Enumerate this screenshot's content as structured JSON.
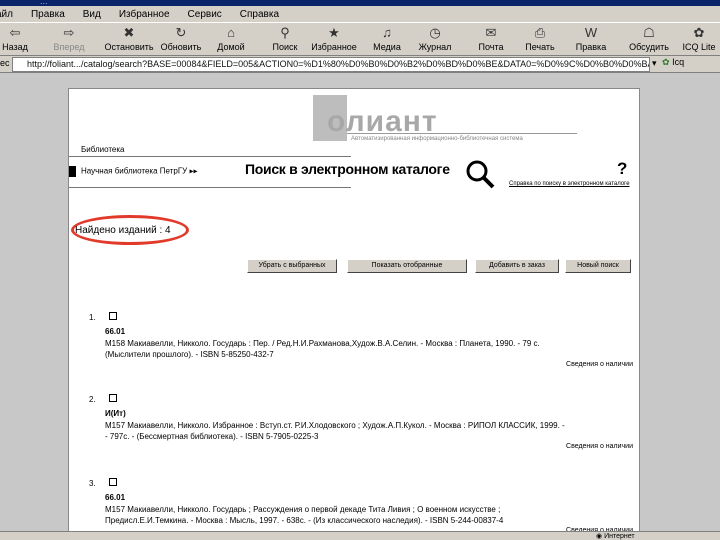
{
  "window": {
    "title": "..."
  },
  "menu": [
    "айл",
    "Правка",
    "Вид",
    "Избранное",
    "Сервис",
    "Справка"
  ],
  "toolbar": {
    "buttons": [
      {
        "label": "Назад",
        "icon": "back-arrow"
      },
      {
        "label": "Вперед",
        "icon": "forward-arrow"
      },
      {
        "label": "Остановить",
        "icon": "stop"
      },
      {
        "label": "Обновить",
        "icon": "refresh"
      },
      {
        "label": "Домой",
        "icon": "home"
      },
      {
        "label": "Поиск",
        "icon": "search"
      },
      {
        "label": "Избранное",
        "icon": "favorites"
      },
      {
        "label": "Медиа",
        "icon": "media"
      },
      {
        "label": "Журнал",
        "icon": "history"
      },
      {
        "label": "Почта",
        "icon": "mail"
      },
      {
        "label": "Печать",
        "icon": "print"
      },
      {
        "label": "Правка",
        "icon": "edit"
      },
      {
        "label": "Обсудить",
        "icon": "discuss"
      },
      {
        "label": "ICQ Lite",
        "icon": "icq"
      }
    ]
  },
  "address": {
    "label": "ес",
    "url": "http://foliant.../catalog/search?BASE=00084&FIELD=005&ACTION0=%D1%80%D0%B0%D0%B2%D0%BD%D0%BE&DATA0=%D0%9C%D0%B0%D0%BA%D0%B8%D0%B0%D0%B2%D0%B5...",
    "go_label": "",
    "icq_label": "Icq"
  },
  "page": {
    "logo": {
      "text": "олиант",
      "tagline": "Автоматизированная информационно-библиотечная система"
    },
    "biblioteka": "Библиотека",
    "library_link": "Научная библиотека ПетрГУ",
    "search_title": "Поиск в электронном каталоге",
    "search_sub": "Справка по поиску в электронном каталоге",
    "help": "?",
    "found": "Найдено изданий : 4",
    "buttons": [
      "Убрать с выбранных",
      "Показать отобранные",
      "Добавить в заказ",
      "Новый поиск"
    ],
    "records": [
      {
        "num": "1.",
        "code": "66.01",
        "line1": "М158   Макиавелли, Никколо. Государь : Пер. / Ред.Н.И.Рахманова,Худож.В.А.Селин. - Москва : Планета, 1990. - 79 с.",
        "line2": "(Мыслители прошлого). - ISBN 5-85250-432-7",
        "avail": "Сведения о наличии"
      },
      {
        "num": "2.",
        "code": "И(Ит)",
        "line1": "М157   Макиавелли, Никколо. Избранное : Вступ.ст. Р.И.Хлодовского ; Худож.А.П.Кукол. - Москва : РИПОЛ КЛАССИК, 1999. -",
        "line2": "- 797с. - (Бессмертная библиотека). - ISBN 5-7905-0225-3",
        "avail": "Сведения о наличии"
      },
      {
        "num": "3.",
        "code": "66.01",
        "line1": "М157   Макиавелли, Никколо. Государь ; Рассуждения о первой декаде Тита Ливия ; О военном искусстве ;",
        "line2": "Предисл.Е.И.Темкина. - Москва : Мысль, 1997. - 638с. - (Из классического наследия). - ISBN 5-244-00837-4",
        "avail": "Сведения о наличии"
      }
    ]
  },
  "status": {
    "zone": "Интернет"
  }
}
